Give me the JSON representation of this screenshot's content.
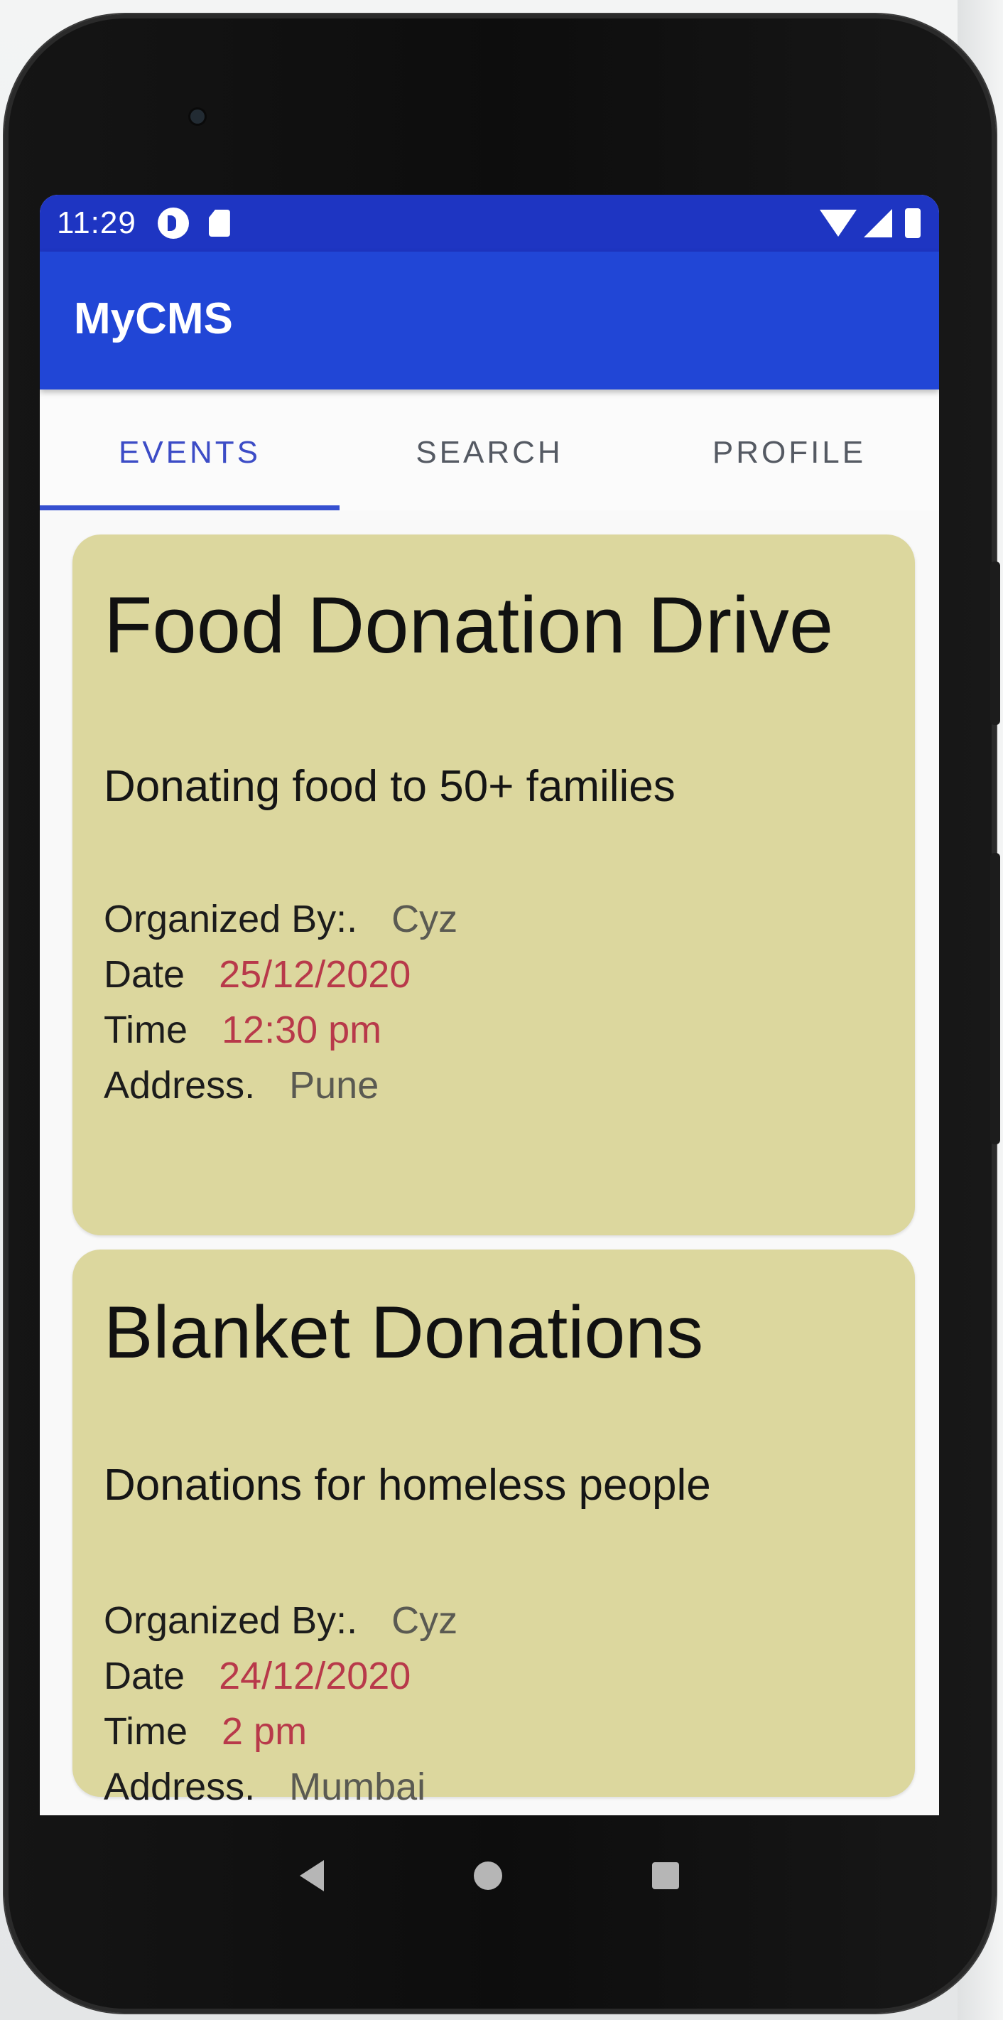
{
  "status_bar": {
    "time": "11:29",
    "icons": [
      "notification-circle-icon",
      "sd-card-icon",
      "wifi-icon",
      "signal-icon",
      "battery-icon"
    ]
  },
  "app_bar": {
    "title": "MyCMS",
    "color": "#2146d6"
  },
  "tabs": [
    {
      "label": "EVENTS",
      "active": true
    },
    {
      "label": "SEARCH",
      "active": false
    },
    {
      "label": "PROFILE",
      "active": false
    }
  ],
  "events": [
    {
      "title": "Food Donation Drive",
      "description": "Donating food to 50+ families",
      "organized_label": "Organized By:.",
      "organized_by": "Cyz",
      "date_label": "Date",
      "date": "25/12/2020",
      "time_label": "Time",
      "time": "12:30 pm",
      "address_label": "Address.",
      "address": "Pune"
    },
    {
      "title": "Blanket Donations",
      "description": "Donations for homeless people",
      "organized_label": "Organized By:.",
      "organized_by": "Cyz",
      "date_label": "Date",
      "date": "24/12/2020",
      "time_label": "Time",
      "time": "2 pm",
      "address_label": "Address.",
      "address": "Mumbai"
    }
  ],
  "nav_bar": {
    "icons": [
      "back-icon",
      "home-icon",
      "recents-icon"
    ]
  },
  "colors": {
    "card_background": "#dcd79e",
    "accent_value": "#b8394a",
    "status_bar": "#1e35c2"
  }
}
